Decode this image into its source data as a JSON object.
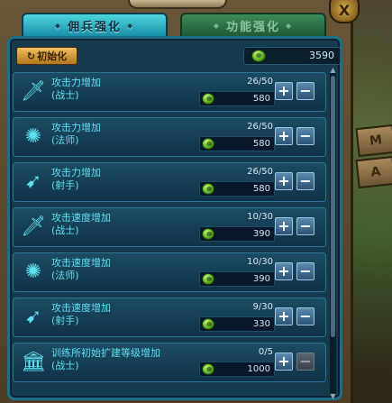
{
  "tabs": [
    {
      "label": "佣兵强化",
      "active": true
    },
    {
      "label": "功能强化",
      "active": false
    }
  ],
  "header": {
    "reset_label": "初始化",
    "gem_total": "3590"
  },
  "decorations": {
    "close_glyph": "X",
    "sign_glyphs": [
      "M",
      "A"
    ]
  },
  "items": [
    {
      "icon": "sword-icon",
      "glyph": "🗡",
      "name": "攻击力增加",
      "sub": "(战士)",
      "level": "26/50",
      "cost": "580",
      "minus_disabled": false
    },
    {
      "icon": "magic-icon",
      "glyph": "✺",
      "name": "攻击力增加",
      "sub": "(法师)",
      "level": "26/50",
      "cost": "580",
      "minus_disabled": false
    },
    {
      "icon": "bow-icon",
      "glyph": "➹",
      "name": "攻击力增加",
      "sub": "(射手)",
      "level": "26/50",
      "cost": "580",
      "minus_disabled": false
    },
    {
      "icon": "sword-icon",
      "glyph": "🗡",
      "name": "攻击速度增加",
      "sub": "(战士)",
      "level": "10/30",
      "cost": "390",
      "minus_disabled": false
    },
    {
      "icon": "magic-icon",
      "glyph": "✺",
      "name": "攻击速度增加",
      "sub": "(法师)",
      "level": "10/30",
      "cost": "390",
      "minus_disabled": false
    },
    {
      "icon": "bow-icon",
      "glyph": "➹",
      "name": "攻击速度增加",
      "sub": "(射手)",
      "level": "9/30",
      "cost": "330",
      "minus_disabled": false
    },
    {
      "icon": "building-icon",
      "glyph": "🏛",
      "name": "训练所初始扩建等级增加",
      "sub": "(战士)",
      "level": "0/5",
      "cost": "1000",
      "minus_disabled": true
    }
  ],
  "buttons": {
    "plus": "+",
    "minus": "−"
  },
  "colors": {
    "accent": "#5ee0f0",
    "panel": "#143a4e",
    "tab_active": "#1a8fa6",
    "tab_inactive": "#1e5a36"
  }
}
